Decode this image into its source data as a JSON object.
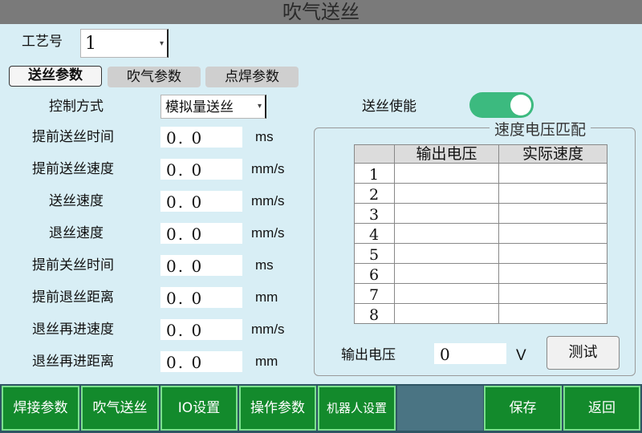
{
  "title": "吹气送丝",
  "process": {
    "label": "工艺号",
    "value": "1"
  },
  "tabs": [
    {
      "label": "送丝参数",
      "active": true
    },
    {
      "label": "吹气参数",
      "active": false
    },
    {
      "label": "点焊参数",
      "active": false
    }
  ],
  "control": {
    "label": "控制方式",
    "value": "模拟量送丝"
  },
  "params": [
    {
      "label": "提前送丝时间",
      "value": "0. 0",
      "unit": "ms"
    },
    {
      "label": "提前送丝速度",
      "value": "0. 0",
      "unit": "mm/s"
    },
    {
      "label": "送丝速度",
      "value": "0. 0",
      "unit": "mm/s"
    },
    {
      "label": "退丝速度",
      "value": "0. 0",
      "unit": "mm/s"
    },
    {
      "label": "提前关丝时间",
      "value": "0. 0",
      "unit": "ms"
    },
    {
      "label": "提前退丝距离",
      "value": "0. 0",
      "unit": "mm"
    },
    {
      "label": "退丝再进速度",
      "value": "0. 0",
      "unit": "mm/s"
    },
    {
      "label": "退丝再进距离",
      "value": "0. 0",
      "unit": "mm"
    }
  ],
  "wire_enable": {
    "label": "送丝使能",
    "on": true
  },
  "match": {
    "title": "速度电压匹配",
    "columns": [
      "输出电压",
      "实际速度"
    ],
    "rows": [
      "1",
      "2",
      "3",
      "4",
      "5",
      "6",
      "7",
      "8"
    ]
  },
  "output": {
    "label": "输出电压",
    "value": "0",
    "unit": "V"
  },
  "test_label": "测试",
  "nav": {
    "weld": "焊接参数",
    "blow": "吹气送丝",
    "io": "IO设置",
    "op": "操作参数",
    "robot": "机器人设置",
    "save": "保存",
    "back": "返回"
  },
  "colors": {
    "nav_bg": "#138a2c",
    "toggle_on": "#3cba7f",
    "background": "#d8eef5"
  }
}
